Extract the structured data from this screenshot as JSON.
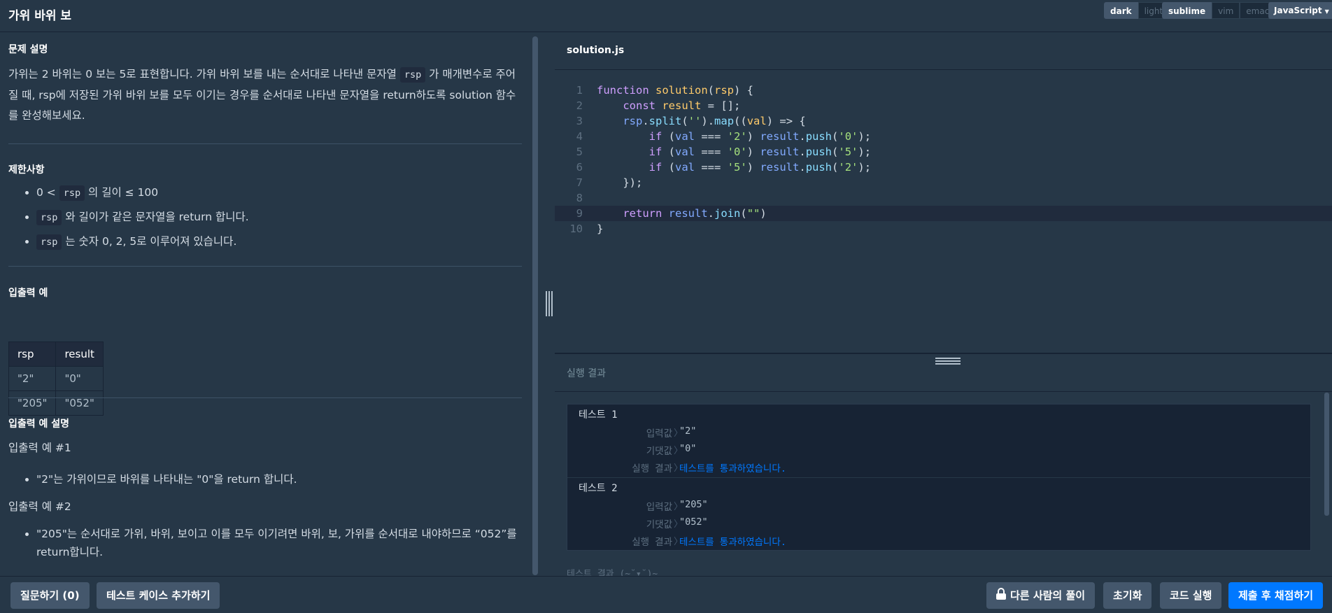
{
  "header": {
    "title": "가위 바위 보",
    "theme": [
      "dark",
      "light"
    ],
    "theme_selected": "dark",
    "keymap": [
      "sublime",
      "vim",
      "emacs"
    ],
    "keymap_selected": "sublime",
    "language": "JavaScript"
  },
  "problem": {
    "desc_heading": "문제 설명",
    "desc_1": "가위는 2 바위는 0 보는 5로 표현합니다. 가위 바위 보를 내는 순서대로 나타낸 문자열 ",
    "desc_code": "rsp",
    "desc_2": " 가 매개변수로 주어질 때, rsp에 저장된 가위 바위 보를 모두 이기는 경우를 순서대로 나타낸 문자열을 return하도록 solution 함수를 완성해보세요.",
    "limit_heading": "제한사항",
    "limits": [
      {
        "pre": "0 < ",
        "code": "rsp",
        "post": " 의 길이 ≤ 100"
      },
      {
        "pre": "",
        "code": "rsp",
        "post": " 와 길이가 같은 문자열을 return 합니다."
      },
      {
        "pre": "",
        "code": "rsp",
        "post": " 는 숫자 0, 2, 5로 이루어져 있습니다."
      }
    ],
    "io_heading": "입출력 예",
    "io_table": {
      "headers": [
        "rsp",
        "result"
      ],
      "rows": [
        [
          "\"2\"",
          "\"0\""
        ],
        [
          "\"205\"",
          "\"052\""
        ]
      ]
    },
    "io_desc_heading": "입출력 예 설명",
    "io_examples": [
      {
        "title": "입출력 예 #1",
        "text": "\"2\"는 가위이므로 바위를 나타내는 \"0\"을 return 합니다."
      },
      {
        "title": "입출력 예 #2",
        "text": "\"205\"는 순서대로 가위, 바위, 보이고 이를 모두 이기려면 바위, 보, 가위를 순서대로 내야하므로 “052”를 return합니다."
      }
    ]
  },
  "editor": {
    "filename": "solution.js",
    "line_numbers": [
      "1",
      "2",
      "3",
      "4",
      "5",
      "6",
      "7",
      "8",
      "9",
      "10"
    ],
    "active_line": 9
  },
  "results": {
    "title": "실행 결과",
    "labels": {
      "input": "입력값",
      "expected": "기댓값",
      "result": "실행 결과",
      "arrow": "〉"
    },
    "tests": [
      {
        "name": "테스트 1",
        "input": "\"2\"",
        "expected": "\"0\"",
        "result": "테스트를 통과하였습니다."
      },
      {
        "name": "테스트 2",
        "input": "\"205\"",
        "expected": "\"052\"",
        "result": "테스트를 통과하였습니다."
      }
    ],
    "footer": "테스트 결과 (~˘▾˘)~"
  },
  "bottom": {
    "question_label": "질문하기 (0)",
    "add_test_label": "테스트 케이스 추가하기",
    "others_label": "다른 사람의 풀이",
    "reset_label": "초기화",
    "run_label": "코드 실행",
    "submit_label": "제출 후 채점하기"
  },
  "colors": {
    "background": "#263747",
    "accent": "#0078ff",
    "button": "#44576c",
    "dark_panel": "#172334"
  }
}
